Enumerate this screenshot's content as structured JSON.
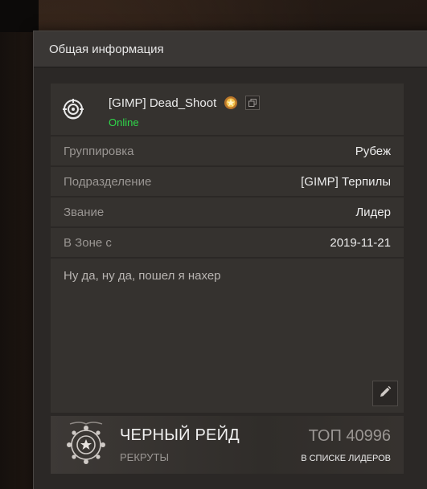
{
  "header": {
    "title": "Общая информация"
  },
  "player": {
    "name": "[GIMP] Dead_Shoot",
    "status": "Online",
    "status_color": "#2fd84a",
    "guild_icon": "crosshair-emblem-icon",
    "badge_icon": "gold-medal-icon",
    "copy_icon": "copy-icon"
  },
  "info_rows": [
    {
      "label": "Группировка",
      "value": "Рубеж"
    },
    {
      "label": "Подразделение",
      "value": "[GIMP] Терпилы"
    },
    {
      "label": "Звание",
      "value": "Лидер"
    },
    {
      "label": "В Зоне с",
      "value": "2019-11-21"
    }
  ],
  "about": {
    "text": "Ну да, ну да, пошел я нахер",
    "edit_icon": "pencil-icon"
  },
  "raid": {
    "name": "ЧЕРНЫЙ РЕЙД",
    "tier": "РЕКРУТЫ",
    "rank_value": "ТОП 40996",
    "rank_label": "В СПИСКЕ ЛИДЕРОВ",
    "emblem_icon": "raid-emblem-icon"
  }
}
